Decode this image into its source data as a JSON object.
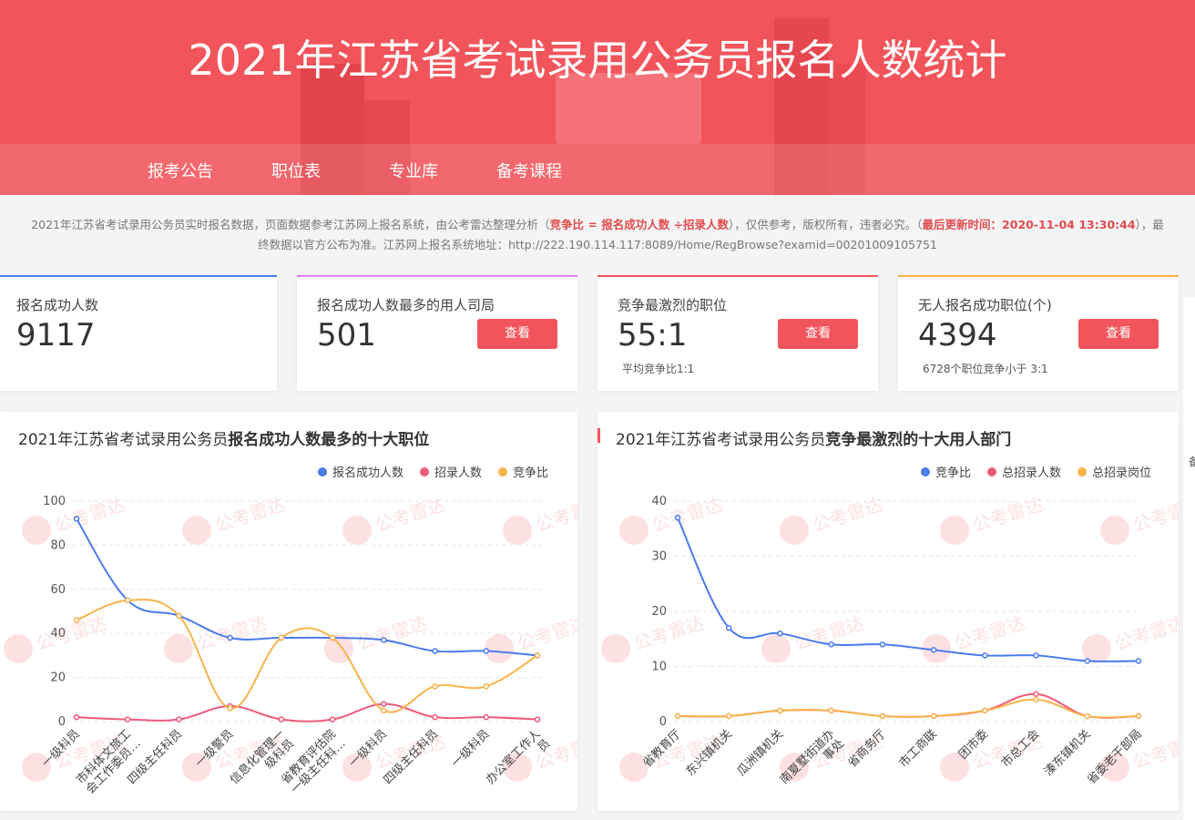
{
  "header": {
    "title": "2021年江苏省考试录用公务员报名人数统计",
    "nav": [
      "报考公告",
      "职位表",
      "专业库",
      "备考课程"
    ]
  },
  "notice": {
    "line1_a": "2021年江苏省考试录用公务员实时报名数据，页面数据参考江苏网上报名系统，由公考雷达整理分析（",
    "line1_formula": "竞争比 = 报名成功人数 ÷招录人数",
    "line1_b": "），仅供参考，版权所有，违者必究。（",
    "line1_update": "最后更新时间：2020-11-04 13:30:44",
    "line1_c": "），最",
    "line2": "终数据以官方公布为准。江苏网上报名系统地址：http://222.190.114.117:8089/Home/RegBrowse?examid=00201009105751"
  },
  "cards": [
    {
      "label": "报名成功人数",
      "value": "9117",
      "sub": "",
      "button": "",
      "accent": "#4b7bec"
    },
    {
      "label": "报名成功人数最多的用人司局",
      "value": "501",
      "sub": "",
      "button": "查看",
      "accent": "#e17ef0"
    },
    {
      "label": "竞争最激烈的职位",
      "value": "55:1",
      "sub": "平均竞争比1:1",
      "button": "查看",
      "accent": "#f2545b"
    },
    {
      "label": "无人报名成功职位(个)",
      "value": "4394",
      "sub": "6728个职位竞争小于 3:1",
      "button": "查看",
      "accent": "#f6b24a"
    }
  ],
  "panels": {
    "left_title_a": "2021年江苏省考试录用公务员",
    "left_title_b": "报名成功人数最多的十大职位",
    "right_title_a": "2021年江苏省考试录用公务员",
    "right_title_b": "竞争最激烈的十大用人部门"
  },
  "right_edge_text": "备",
  "watermark": "公考雷达",
  "colors": {
    "brand": "#f2545b",
    "blue": "#4b7bec",
    "pink": "#f0597c",
    "orange": "#f8b34a"
  },
  "chart_data": [
    {
      "type": "line",
      "categories": [
        "一级科员",
        "市科体文旅工会工作委员…",
        "四级主任科员",
        "一级警员",
        "信息化管理一级科员",
        "省教育评估院一级主任科…",
        "一级科员",
        "四级主任科员",
        "一级科员",
        "办公室工作人员"
      ],
      "series": [
        {
          "name": "报名成功人数",
          "values": [
            92,
            55,
            48,
            38,
            38,
            38,
            37,
            32,
            32,
            30
          ],
          "color": "#4b7bec"
        },
        {
          "name": "招录人数",
          "values": [
            2,
            1,
            1,
            7,
            1,
            1,
            8,
            2,
            2,
            1
          ],
          "color": "#f0597c"
        },
        {
          "name": "竞争比",
          "values": [
            46,
            55,
            48,
            6,
            38,
            38,
            5,
            16,
            16,
            30
          ],
          "color": "#f8b34a"
        }
      ],
      "ylim": [
        0,
        100
      ],
      "yticks": [
        0,
        20,
        40,
        60,
        80,
        100
      ],
      "grid": true,
      "legend": "top-right"
    },
    {
      "type": "line",
      "categories": [
        "省教育厅",
        "东兴镇机关",
        "瓜洲镇机关",
        "南夏墅街道办事处",
        "省商务厅",
        "市工商联",
        "团市委",
        "市总工会",
        "溱东镇机关",
        "省委老干部局"
      ],
      "series": [
        {
          "name": "竞争比",
          "values": [
            37,
            17,
            16,
            14,
            14,
            13,
            12,
            12,
            11,
            11
          ],
          "color": "#4b7bec"
        },
        {
          "name": "总招录人数",
          "values": [
            1,
            1,
            2,
            2,
            1,
            1,
            2,
            5,
            1,
            1
          ],
          "color": "#f0597c"
        },
        {
          "name": "总招录岗位",
          "values": [
            1,
            1,
            2,
            2,
            1,
            1,
            2,
            4,
            1,
            1
          ],
          "color": "#f8b34a"
        }
      ],
      "ylim": [
        0,
        40
      ],
      "yticks": [
        0,
        10,
        20,
        30,
        40
      ],
      "grid": true,
      "legend": "top-right"
    }
  ]
}
